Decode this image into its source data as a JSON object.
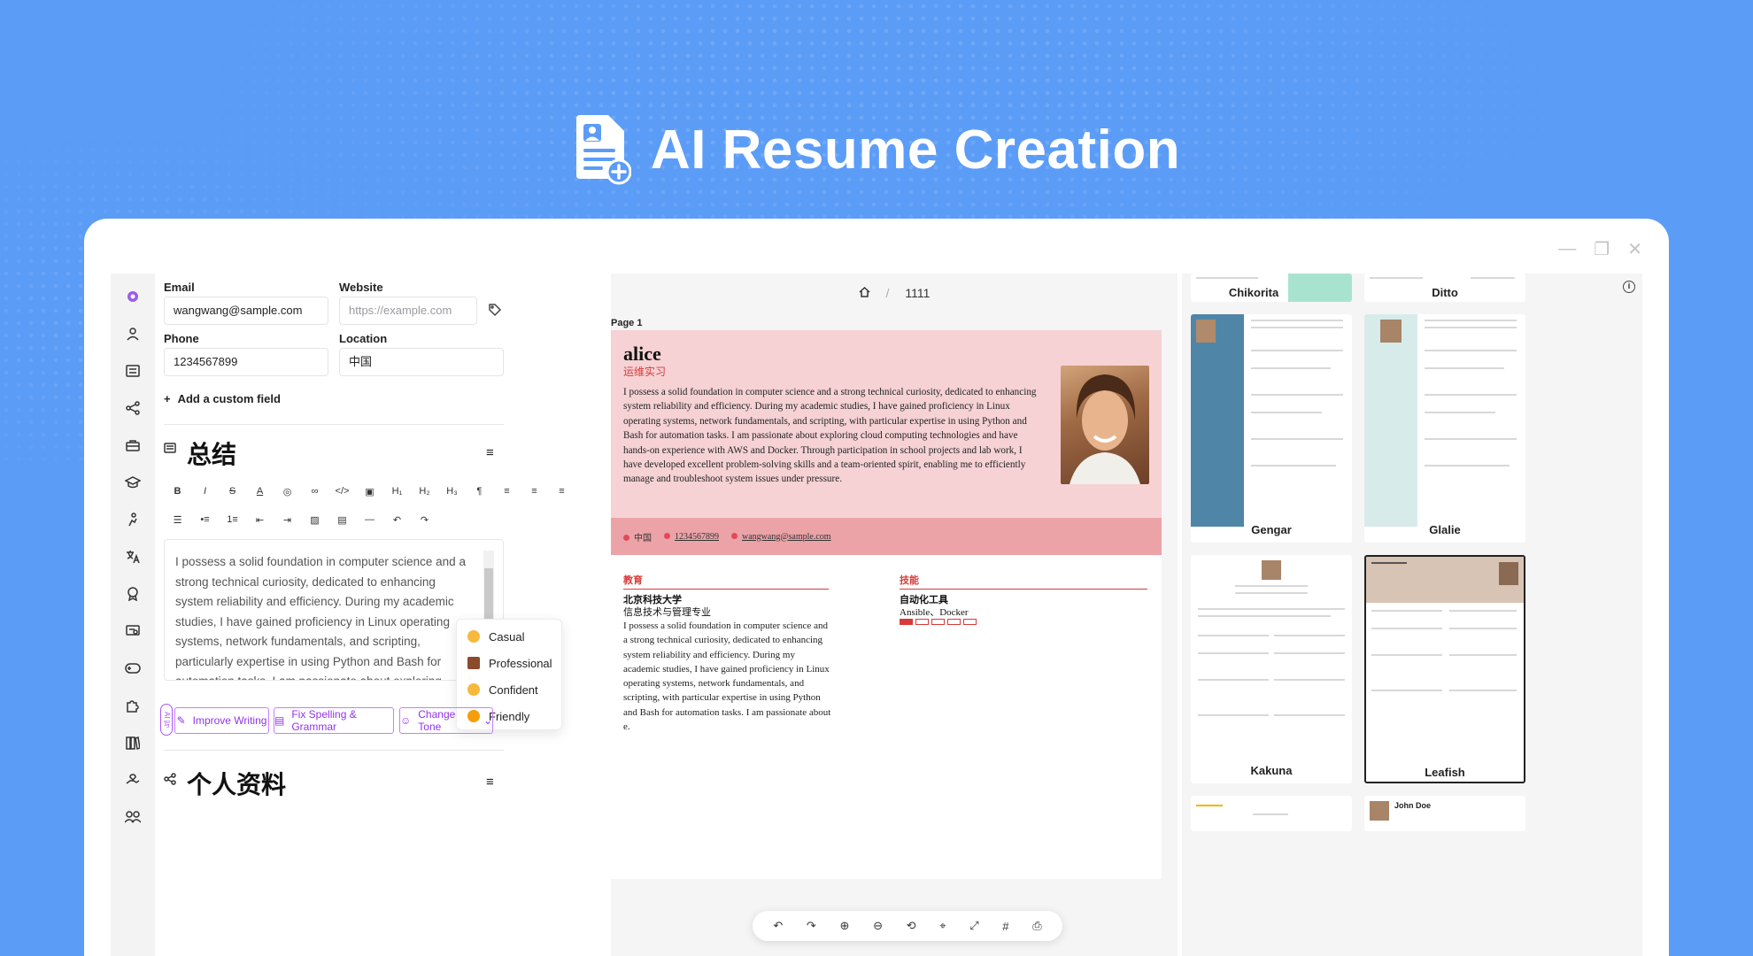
{
  "hero": {
    "title": "AI Resume Creation"
  },
  "form": {
    "email_label": "Email",
    "email_value": "wangwang@sample.com",
    "website_label": "Website",
    "website_placeholder": "https://example.com",
    "phone_label": "Phone",
    "phone_value": "1234567899",
    "location_label": "Location",
    "location_value": "中国",
    "add_custom_field": "Add a custom field",
    "summary_title": "总结",
    "summary_text": "I possess a solid foundation in computer science and a strong technical curiosity, dedicated to enhancing system reliability and efficiency. During my academic studies, I have gained proficiency in Linux operating systems, network fundamentals, and scripting, particularly expertise in using Python and Bash for automation tasks. I am passionate about exploring cloud computing technologies and have hands-on experience with AWS and Docker. Through participation in school projects and lab work, I have developed excellent problem-solving skills",
    "tone_options": [
      "Casual",
      "Professional",
      "Confident",
      "Friendly"
    ],
    "ai_tag": "AI 写",
    "improve_writing": "Improve Writing",
    "fix_spelling": "Fix Spelling & Grammar",
    "change_tone": "Change Tone",
    "profiles_title": "个人资料"
  },
  "preview": {
    "breadcrumb": "1111",
    "page_label": "Page 1",
    "name": "alice",
    "role": "运维实习",
    "summary": "I possess a solid foundation in computer science and a strong technical curiosity, dedicated to enhancing system reliability and efficiency. During my academic studies, I have gained proficiency in Linux operating systems, network fundamentals, and scripting, with particular expertise in using Python and Bash for automation tasks. I am passionate about exploring cloud computing technologies and have hands-on experience with AWS and Docker. Through participation in school projects and lab work, I have developed excellent problem-solving skills and a team-oriented spirit, enabling me to efficiently manage and troubleshoot system issues under pressure.",
    "contact_location": "中国",
    "contact_phone": "1234567899",
    "contact_email": "wangwang@sample.com",
    "education_title": "教育",
    "school": "北京科技大学",
    "major": "信息技术与管理专业",
    "education_text": "I possess a solid foundation in computer science and a strong technical curiosity, dedicated to enhancing system reliability and efficiency. During my academic studies, I have gained proficiency in Linux operating systems, network fundamentals, and scripting, with particular expertise in using Python and Bash for automation tasks. I am passionate about e.",
    "skills_title": "技能",
    "skill_name": "自动化工具",
    "skill_keywords": "Ansible、Docker",
    "skill_level": 1,
    "skill_level_max": 5
  },
  "templates": [
    "Chikorita",
    "Ditto",
    "Gengar",
    "Glalie",
    "Kakuna",
    "Leafish"
  ],
  "template_selected": "Leafish",
  "template_sample_name": "John Doe",
  "colors": {
    "accent": "#d93a3a",
    "ai": "#9333ea",
    "hero_bg": "#5b9cf7"
  }
}
